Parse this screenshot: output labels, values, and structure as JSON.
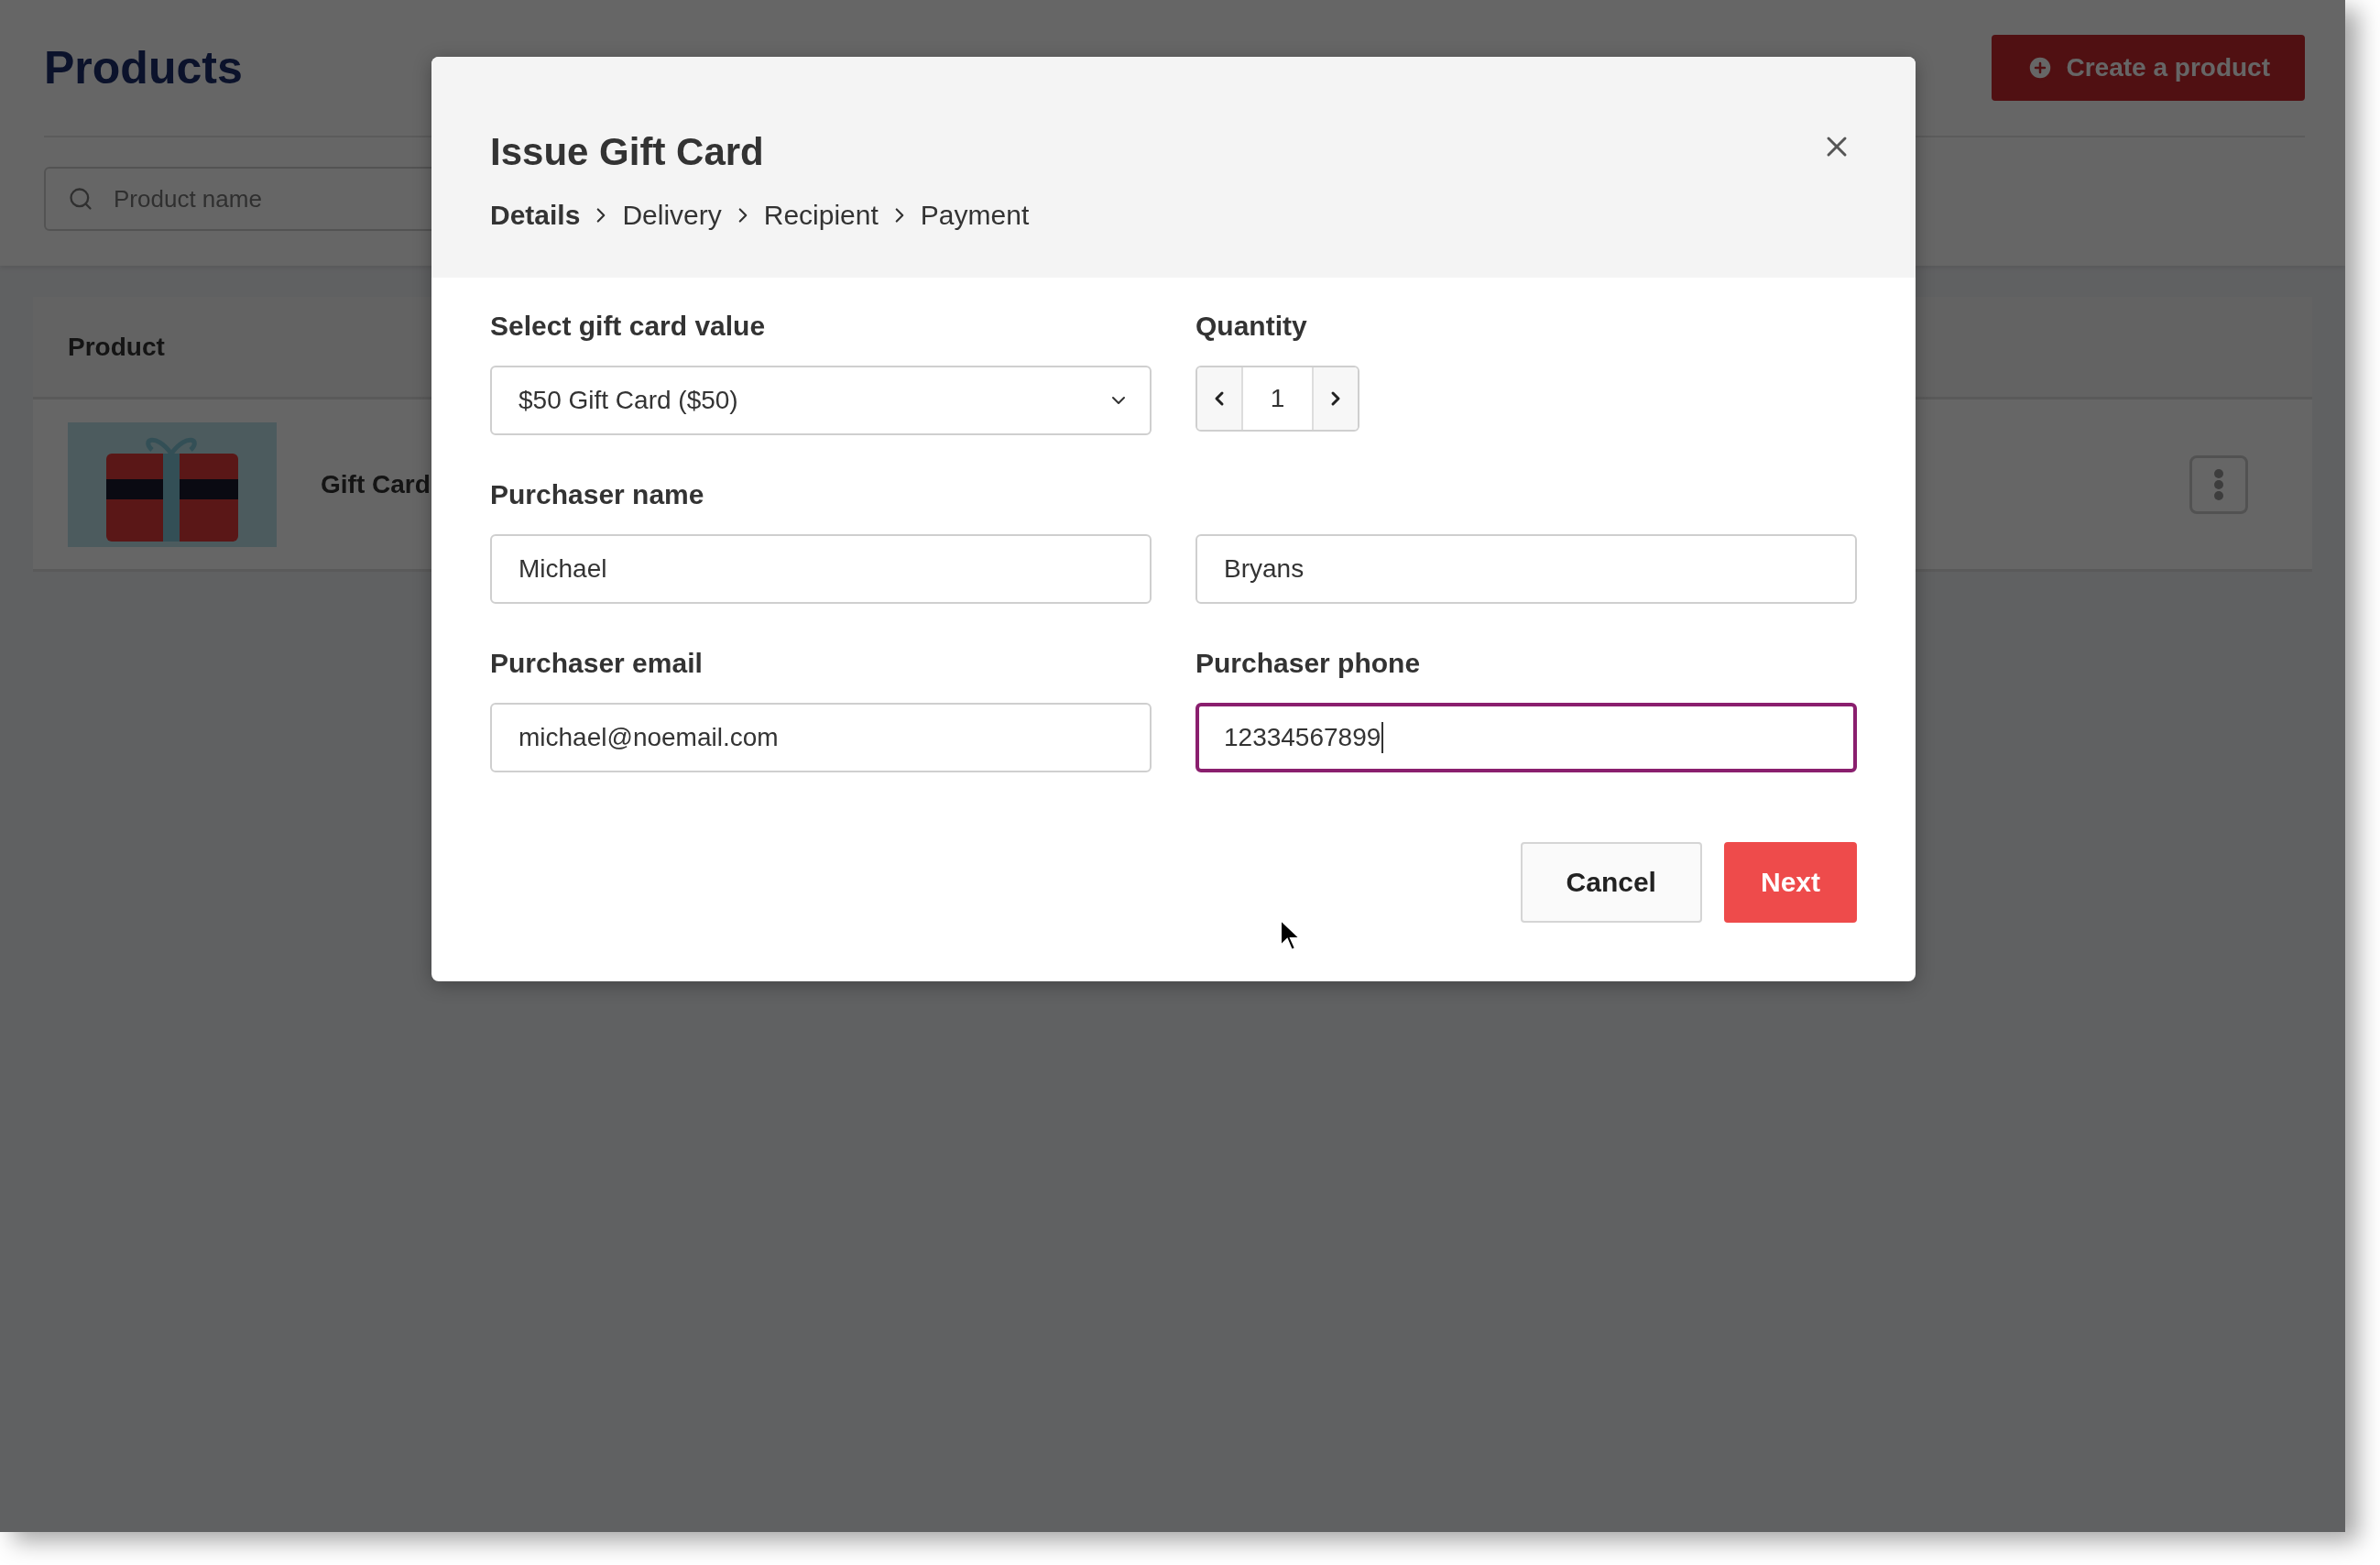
{
  "page": {
    "title": "Products",
    "create_button": "Create a product",
    "search": {
      "placeholder": "Product name"
    }
  },
  "table": {
    "columns": [
      "Product"
    ],
    "rows": [
      {
        "name": "Gift Card"
      }
    ]
  },
  "modal": {
    "title": "Issue Gift Card",
    "steps": [
      {
        "label": "Details",
        "current": true
      },
      {
        "label": "Delivery",
        "current": false
      },
      {
        "label": "Recipient",
        "current": false
      },
      {
        "label": "Payment",
        "current": false
      }
    ],
    "value_label": "Select gift card value",
    "value": "$50 Gift Card ($50)",
    "quantity_label": "Quantity",
    "quantity": "1",
    "name_label": "Purchaser name",
    "first_name": {
      "value": "Michael",
      "focused": false
    },
    "last_name": {
      "value": "Bryans",
      "focused": false
    },
    "email_label": "Purchaser email",
    "email": {
      "value": "michael@noemail.com",
      "focused": false
    },
    "phone_label": "Purchaser phone",
    "phone": {
      "value": "12334567899",
      "focused": true
    },
    "buttons": [
      {
        "label": "Cancel",
        "kind": "secondary"
      },
      {
        "label": "Next",
        "kind": "primary"
      }
    ]
  }
}
